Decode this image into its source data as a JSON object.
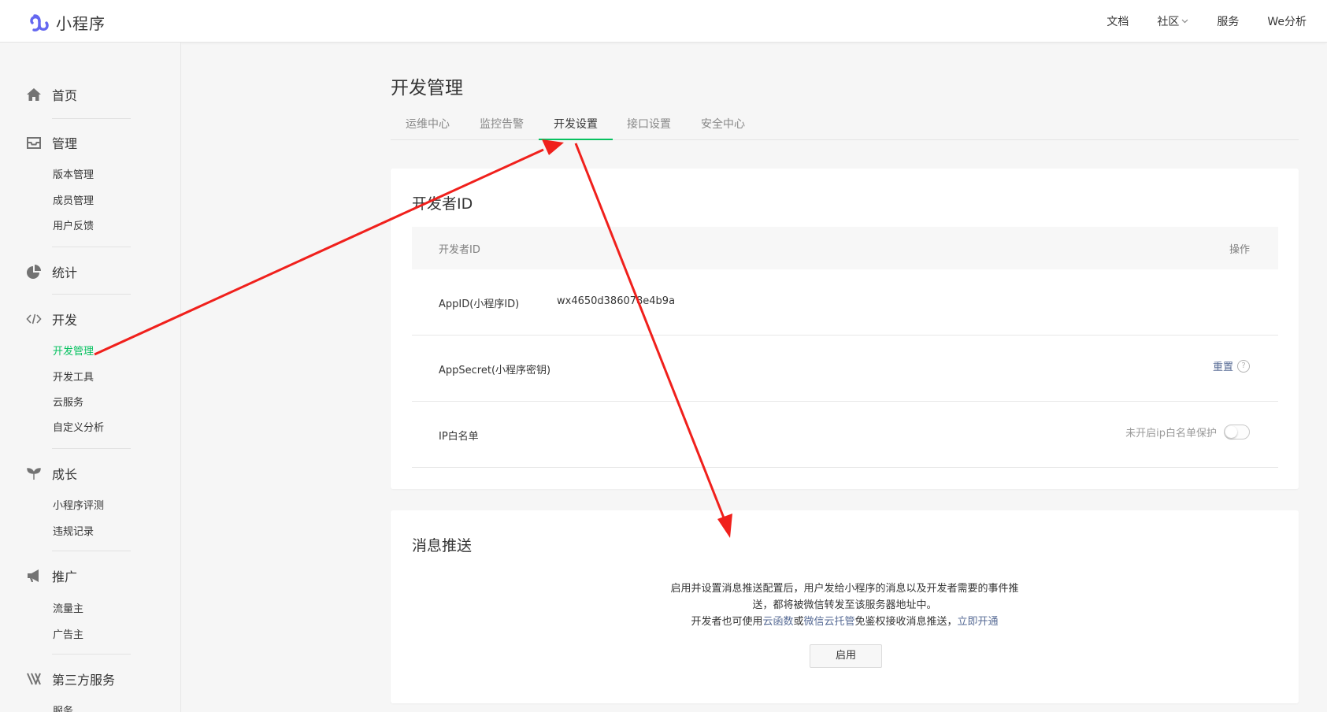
{
  "header": {
    "logo_text": "小程序",
    "nav": [
      "文档",
      "社区",
      "服务",
      "We分析"
    ]
  },
  "sidebar": {
    "groups": [
      {
        "label": "首页",
        "icon": "home-icon",
        "items": []
      },
      {
        "label": "管理",
        "icon": "inbox-icon",
        "items": [
          "版本管理",
          "成员管理",
          "用户反馈"
        ]
      },
      {
        "label": "统计",
        "icon": "pie-chart-icon",
        "items": []
      },
      {
        "label": "开发",
        "icon": "code-icon",
        "items": [
          "开发管理",
          "开发工具",
          "云服务",
          "自定义分析"
        ]
      },
      {
        "label": "成长",
        "icon": "sprout-icon",
        "items": [
          "小程序评测",
          "违规记录"
        ]
      },
      {
        "label": "推广",
        "icon": "megaphone-icon",
        "items": [
          "流量主",
          "广告主"
        ]
      },
      {
        "label": "第三方服务",
        "icon": "third-party-icon",
        "items": [
          "服务"
        ]
      }
    ],
    "active_item": "开发管理"
  },
  "main": {
    "title": "开发管理",
    "tabs": [
      "运维中心",
      "监控告警",
      "开发设置",
      "接口设置",
      "安全中心"
    ],
    "active_tab": "开发设置",
    "developer_card": {
      "title": "开发者ID",
      "table_header": {
        "col1": "开发者ID",
        "col2": "操作"
      },
      "rows": [
        {
          "label": "AppID(小程序ID)",
          "value": "wx4650d386078e4b9a"
        },
        {
          "label": "AppSecret(小程序密钥)",
          "action": "重置",
          "help": "?"
        },
        {
          "label": "IP白名单",
          "status": "未开启ip白名单保护",
          "toggle_on": false
        }
      ]
    },
    "push_card": {
      "title": "消息推送",
      "desc_line1": "启用并设置消息推送配置后，用户发给小程序的消息以及开发者需要的事件推",
      "desc_line2": "送，都将被微信转发至该服务器地址中。",
      "desc_line3_pre": "开发者也可使用",
      "link_cloud_func": "云函数",
      "desc_or": "或",
      "link_cloud_hosting": "微信云托管",
      "desc_line3_post": "免鉴权接收消息推送，",
      "link_open": "立即开通",
      "button": "启用"
    }
  },
  "colors": {
    "accent": "#07c160",
    "link": "#576b95",
    "annotation": "#f0201c",
    "logo": "#6467f0"
  }
}
